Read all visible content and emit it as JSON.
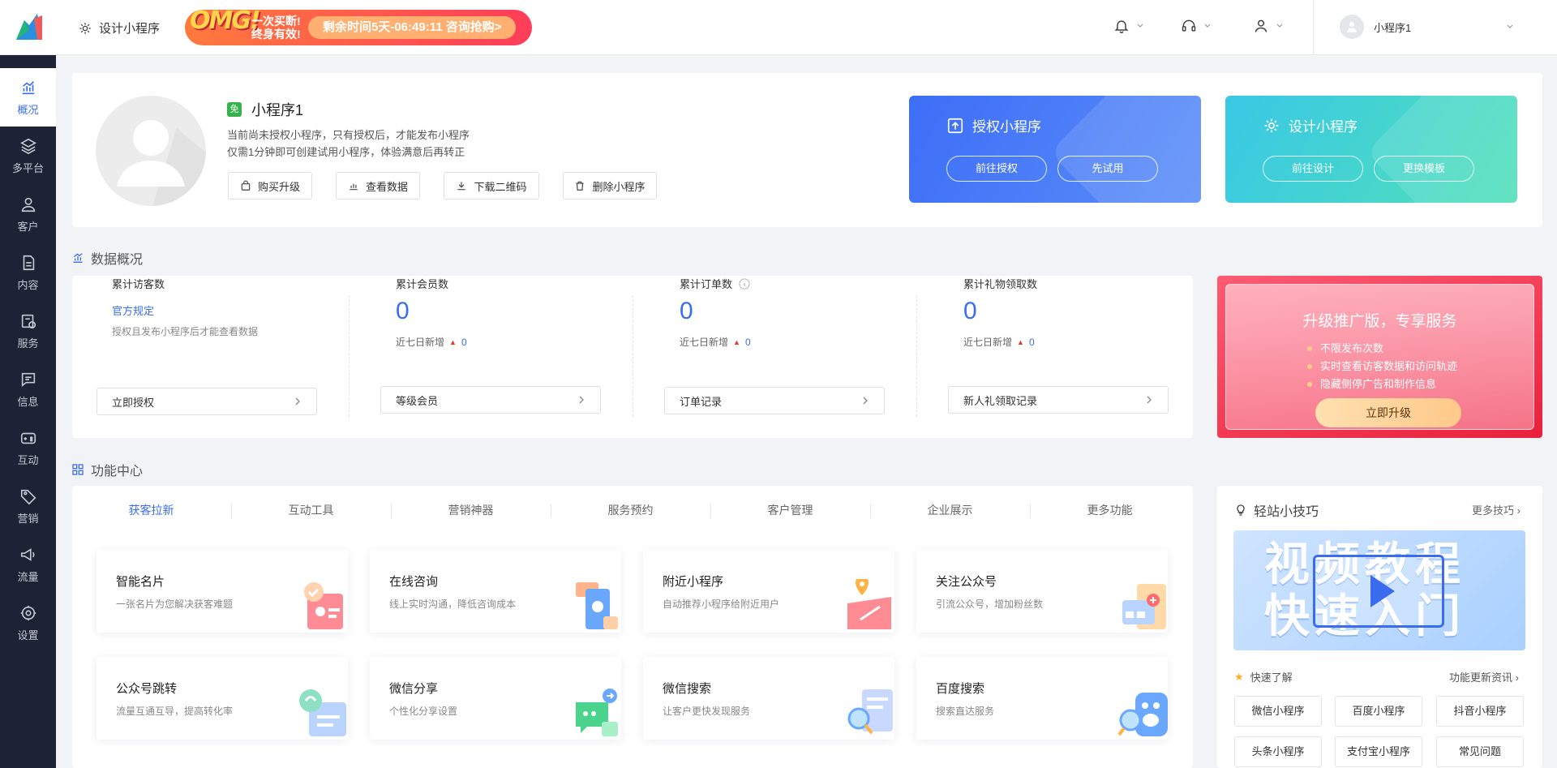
{
  "header": {
    "design_link": "设计小程序",
    "promo": {
      "omg": "OMG!",
      "tag_line1": "一次买断!",
      "tag_line2": "终身有效!",
      "countdown": "剩余时间5天-06:49:11 咨询抢购>"
    },
    "user_name": "小程序1"
  },
  "sidebar": {
    "items": [
      {
        "label": "概况",
        "icon": "chart-icon"
      },
      {
        "label": "多平台",
        "icon": "layers-icon"
      },
      {
        "label": "客户",
        "icon": "user-icon"
      },
      {
        "label": "内容",
        "icon": "document-icon"
      },
      {
        "label": "服务",
        "icon": "service-icon"
      },
      {
        "label": "信息",
        "icon": "message-icon"
      },
      {
        "label": "互动",
        "icon": "gamepad-icon"
      },
      {
        "label": "营销",
        "icon": "tag-icon"
      },
      {
        "label": "流量",
        "icon": "megaphone-icon"
      },
      {
        "label": "设置",
        "icon": "gear-icon"
      }
    ]
  },
  "app": {
    "badge": "免",
    "name": "小程序1",
    "desc1": "当前尚未授权小程序，只有授权后，才能发布小程序",
    "desc2": "仅需1分钟即可创建试用小程序，体验满意后再转正",
    "actions": [
      "购买升级",
      "查看数据",
      "下载二维码",
      "删除小程序"
    ]
  },
  "auth_card": {
    "title": "授权小程序",
    "btn1": "前往授权",
    "btn2": "先试用"
  },
  "design_card": {
    "title": "设计小程序",
    "btn1": "前往设计",
    "btn2": "更换模板"
  },
  "data_overview": {
    "title": "数据概况",
    "visitors": {
      "label": "累计访客数",
      "link": "官方规定",
      "note": "授权且发布小程序后才能查看数据",
      "button": "立即授权"
    },
    "members": {
      "label": "累计会员数",
      "value": "0",
      "week_label": "近七日新增",
      "week_value": "0",
      "button": "等级会员"
    },
    "orders": {
      "label": "累计订单数",
      "value": "0",
      "week_label": "近七日新增",
      "week_value": "0",
      "button": "订单记录"
    },
    "gifts": {
      "label": "累计礼物领取数",
      "value": "0",
      "week_label": "近七日新增",
      "week_value": "0",
      "button": "新人礼领取记录"
    }
  },
  "upgrade": {
    "title": "升级推广版，专享服务",
    "items": [
      "不限发布次数",
      "实时查看访客数据和访问轨迹",
      "隐藏侧停广告和制作信息"
    ],
    "button": "立即升级"
  },
  "features": {
    "title": "功能中心",
    "tabs": [
      "获客拉新",
      "互动工具",
      "营销神器",
      "服务预约",
      "客户管理",
      "企业展示",
      "更多功能"
    ],
    "cards": [
      {
        "title": "智能名片",
        "desc": "一张名片为您解决获客难题"
      },
      {
        "title": "在线咨询",
        "desc": "线上实时沟通，降低咨询成本"
      },
      {
        "title": "附近小程序",
        "desc": "自动推荐小程序给附近用户"
      },
      {
        "title": "关注公众号",
        "desc": "引流公众号，增加粉丝数"
      },
      {
        "title": "公众号跳转",
        "desc": "流量互通互导，提高转化率"
      },
      {
        "title": "微信分享",
        "desc": "个性化分享设置"
      },
      {
        "title": "微信搜索",
        "desc": "让客户更快发现服务"
      },
      {
        "title": "百度搜索",
        "desc": "搜索直达服务"
      }
    ]
  },
  "tips": {
    "title": "轻站小技巧",
    "more": "更多技巧",
    "video_line1": "视频教程",
    "video_line2": "快速入门",
    "quick": "快速了解",
    "updates": "功能更新资讯",
    "pills": [
      "微信小程序",
      "百度小程序",
      "抖音小程序",
      "头条小程序",
      "支付宝小程序",
      "常见问题"
    ]
  },
  "colors": {
    "accent": "#3a6df0",
    "sidebar_bg": "#1e2235",
    "promo": "#ff3d5a"
  }
}
